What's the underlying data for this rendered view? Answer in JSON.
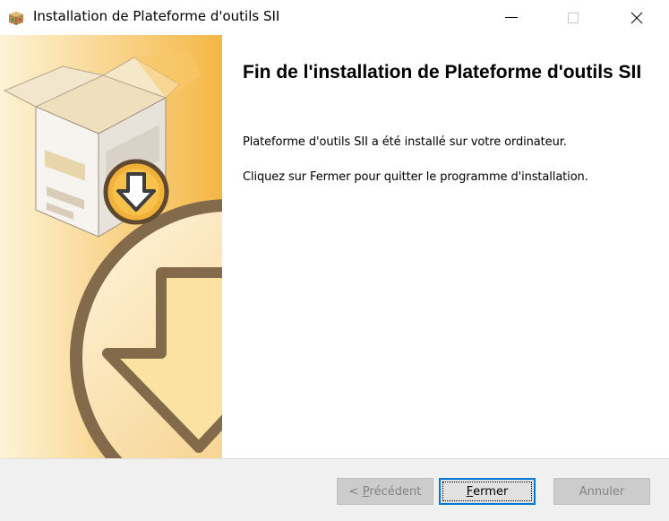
{
  "window": {
    "title": "Installation de Plateforme d'outils SII"
  },
  "page": {
    "heading": "Fin de l'installation de Plateforme d'outils SII",
    "message_installed": "Plateforme d'outils SII a été installé sur votre ordinateur.",
    "message_close": "Cliquez sur Fermer pour quitter le programme d'installation."
  },
  "buttons": {
    "previous_prefix": "< ",
    "previous_mnemonic": "P",
    "previous_rest": "récédent",
    "close_mnemonic": "F",
    "close_rest": "ermer",
    "cancel": "Annuler"
  },
  "icons": {
    "app": "installer-box-icon",
    "sidebar": "installer-box-download-graphic"
  },
  "colors": {
    "sidebar_light": "#fdf3d6",
    "sidebar_dark": "#f5b746",
    "focus_blue": "#0078d7"
  }
}
